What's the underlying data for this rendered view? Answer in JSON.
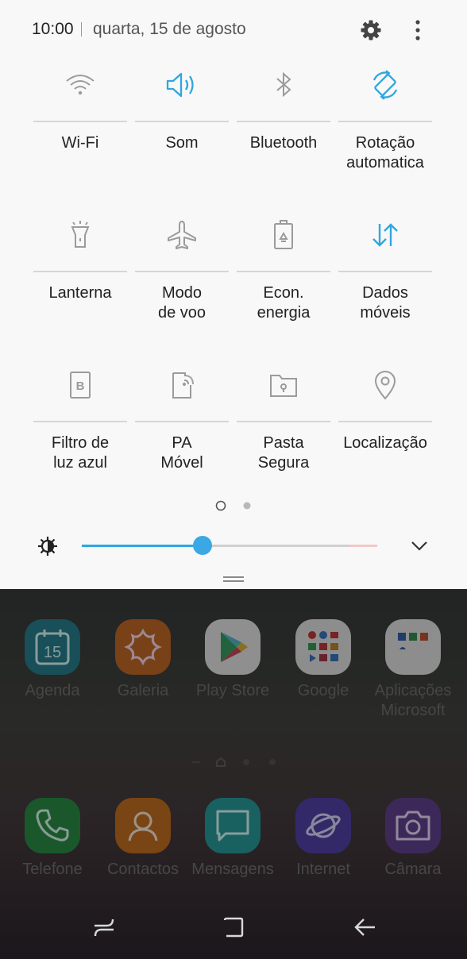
{
  "status": {
    "time": "10:00",
    "date": "quarta, 15 de agosto"
  },
  "quick_panel": {
    "tiles": [
      {
        "label": "Wi-Fi",
        "icon": "wifi-icon",
        "active": false
      },
      {
        "label": "Som",
        "icon": "sound-icon",
        "active": true
      },
      {
        "label": "Bluetooth",
        "icon": "bluetooth-icon",
        "active": false
      },
      {
        "label": "Rotação\nautomatica",
        "icon": "auto-rotate-icon",
        "active": true
      },
      {
        "label": "Lanterna",
        "icon": "flashlight-icon",
        "active": false
      },
      {
        "label": "Modo\nde voo",
        "icon": "airplane-icon",
        "active": false
      },
      {
        "label": "Econ.\nenergia",
        "icon": "battery-saver-icon",
        "active": false
      },
      {
        "label": "Dados\nmóveis",
        "icon": "mobile-data-icon",
        "active": true
      },
      {
        "label": "Filtro de\nluz azul",
        "icon": "blue-light-filter-icon",
        "active": false
      },
      {
        "label": "PA\nMóvel",
        "icon": "mobile-hotspot-icon",
        "active": false
      },
      {
        "label": "Pasta\nSegura",
        "icon": "secure-folder-icon",
        "active": false
      },
      {
        "label": "Localização",
        "icon": "location-icon",
        "active": false
      }
    ],
    "page_count": 2,
    "current_page": 1,
    "brightness": 0.41
  },
  "colors": {
    "accent": "#2fa7e0",
    "inactive_icon": "#9b9b9b",
    "panel_bg": "#f8f8f8"
  },
  "home": {
    "apps": [
      {
        "label": "Agenda",
        "icon": "calendar-icon",
        "color": "#1d7a8a"
      },
      {
        "label": "Galeria",
        "icon": "gallery-icon",
        "color": "#c2621c"
      },
      {
        "label": "Play Store",
        "icon": "play-store-icon",
        "color": "#e8e8e8"
      },
      {
        "label": "Google",
        "icon": "google-folder-icon",
        "color": "#e6e6e6"
      },
      {
        "label": "Aplicações\nMicrosoft",
        "icon": "microsoft-folder-icon",
        "color": "#e6e6e6"
      }
    ],
    "calendar_day": "15",
    "dock": [
      {
        "label": "Telefone",
        "icon": "phone-icon",
        "color": "#1f8a3e"
      },
      {
        "label": "Contactos",
        "icon": "contacts-icon",
        "color": "#c46a16"
      },
      {
        "label": "Mensagens",
        "icon": "messages-icon",
        "color": "#1e9a9a"
      },
      {
        "label": "Internet",
        "icon": "internet-icon",
        "color": "#4a3aa8"
      },
      {
        "label": "Câmara",
        "icon": "camera-icon",
        "color": "#5a3a8c"
      }
    ]
  }
}
